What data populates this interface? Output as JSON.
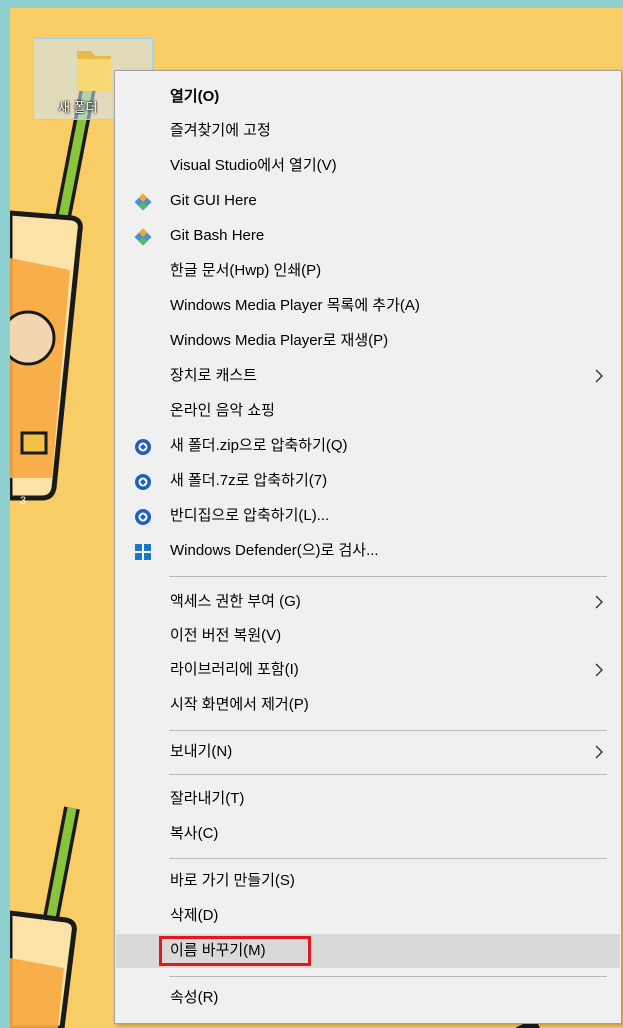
{
  "desktop": {
    "folder_label": "새 폴더"
  },
  "context_menu": {
    "items": [
      {
        "label": "열기(O)",
        "bold": true
      },
      {
        "label": "즐겨찾기에 고정"
      },
      {
        "label": "Visual Studio에서 열기(V)"
      },
      {
        "label": "Git GUI Here",
        "icon": "git-icon"
      },
      {
        "label": "Git Bash Here",
        "icon": "git-icon"
      },
      {
        "label": "한글 문서(Hwp) 인쇄(P)"
      },
      {
        "label": "Windows Media Player 목록에 추가(A)"
      },
      {
        "label": "Windows Media Player로 재생(P)"
      },
      {
        "label": "장치로 캐스트",
        "submenu": true
      },
      {
        "label": "온라인 음악 쇼핑"
      },
      {
        "label": "새 폴더.zip으로 압축하기(Q)",
        "icon": "bandizip-icon"
      },
      {
        "label": "새 폴더.7z로 압축하기(7)",
        "icon": "bandizip-icon"
      },
      {
        "label": "반디집으로 압축하기(L)...",
        "icon": "bandizip-icon"
      },
      {
        "label": "Windows Defender(으)로 검사...",
        "icon": "defender-shield-icon"
      },
      {
        "label": "액세스 권한 부여 (G)",
        "submenu": true
      },
      {
        "label": "이전 버전 복원(V)"
      },
      {
        "label": "라이브러리에 포함(I)",
        "submenu": true
      },
      {
        "label": "시작 화면에서 제거(P)"
      },
      {
        "label": "보내기(N)",
        "submenu": true
      },
      {
        "label": "잘라내기(T)"
      },
      {
        "label": "복사(C)"
      },
      {
        "label": "바로 가기 만들기(S)"
      },
      {
        "label": "삭제(D)"
      },
      {
        "label": "이름 바꾸기(M)",
        "hovered": true,
        "highlighted": true
      },
      {
        "label": "속성(R)"
      }
    ]
  },
  "colors": {
    "wallpaper": "#f9cd66",
    "desktop_border": "#8ecfd0",
    "menu_bg": "#f0f0f0",
    "hover_bg": "#d9d9d9",
    "highlight_border": "#e0191f"
  }
}
